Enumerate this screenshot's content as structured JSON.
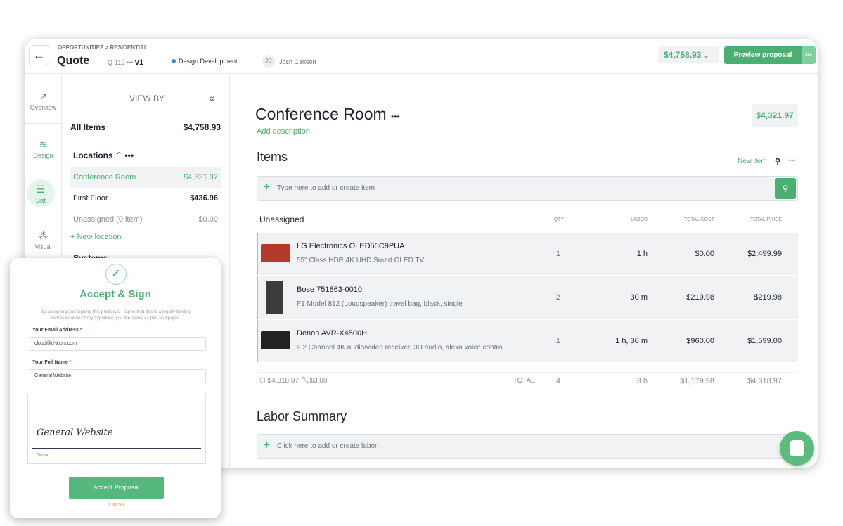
{
  "header": {
    "breadcrumb": "OPPORTUNITIES > RESIDENTIAL",
    "title": "Quote",
    "quote_id": "Q-112",
    "version": "v1",
    "status": "Design Development",
    "status_color": "#2e8fe0",
    "user_initials": "JC",
    "user_name": "Josh Carlson",
    "total": "$4,758.93",
    "preview_label": "Preview proposal"
  },
  "rail": {
    "items": [
      {
        "label": "Overview",
        "icon": "trend-icon"
      },
      {
        "label": "Design",
        "icon": "layers-icon"
      },
      {
        "label": "List",
        "icon": "list-icon"
      },
      {
        "label": "Visual",
        "icon": "nodes-icon"
      }
    ]
  },
  "viewby": {
    "title": "VIEW BY",
    "all_items_label": "All Items",
    "all_items_total": "$4,758.93",
    "locations_label": "Locations",
    "locations": [
      {
        "name": "Conference Room",
        "total": "$4,321.97"
      },
      {
        "name": "First Floor",
        "total": "$436.96"
      },
      {
        "name": "Unassigned (0 item)",
        "total": "$0.00"
      }
    ],
    "new_location": "+ New location",
    "systems_label": "Systems"
  },
  "main": {
    "room_title": "Conference Room",
    "room_total": "$4,321.97",
    "add_description": "Add description",
    "items_title": "Items",
    "new_item": "New item",
    "item_placeholder": "Type here to add or create item",
    "group": "Unassigned",
    "columns": [
      "QTY",
      "LABOR",
      "TOTAL COST",
      "TOTAL PRICE"
    ],
    "items": [
      {
        "name": "LG Electronics OLED55C9PUA",
        "desc": "55\" Class HDR 4K UHD Smart OLED TV",
        "qty": "1",
        "labor": "1 h",
        "cost": "$0.00",
        "price": "$2,499.99"
      },
      {
        "name": "Bose 751863-0010",
        "desc": "F1 Model 812 (Loudspeaker) travel bag, black, single",
        "qty": "2",
        "labor": "30 m",
        "cost": "$219.98",
        "price": "$219.98"
      },
      {
        "name": "Denon AVR-X4500H",
        "desc": "9.2 Channel 4K audio/video receiver, 3D audio, alexa voice control",
        "qty": "1",
        "labor": "1 h, 30 m",
        "cost": "$960.00",
        "price": "$1,599.00"
      }
    ],
    "totals": {
      "equipment": "$4,318.97",
      "labor_cost": "$3.00",
      "label": "TOTAL",
      "qty": "4",
      "labor": "3 h",
      "cost": "$1,179.98",
      "price": "$4,318.97"
    },
    "labor_title": "Labor Summary",
    "labor_placeholder": "Click here to add or create labor"
  },
  "modal": {
    "title": "Accept & Sign",
    "disclaimer": "By accepting and signing this proposal, I agree that this is a legally binding representation of my signature, just the same as pen and paper.",
    "email_label": "Your Email Address",
    "email_value": "cloud@d-tools.com",
    "name_label": "Your Full Name",
    "name_value": "General Website",
    "signature": "General Website",
    "draw": "Draw",
    "accept": "Accept Proposal",
    "cancel": "Cancel"
  },
  "colors": {
    "accent": "#4caf72",
    "cancel": "#f29a5c"
  }
}
